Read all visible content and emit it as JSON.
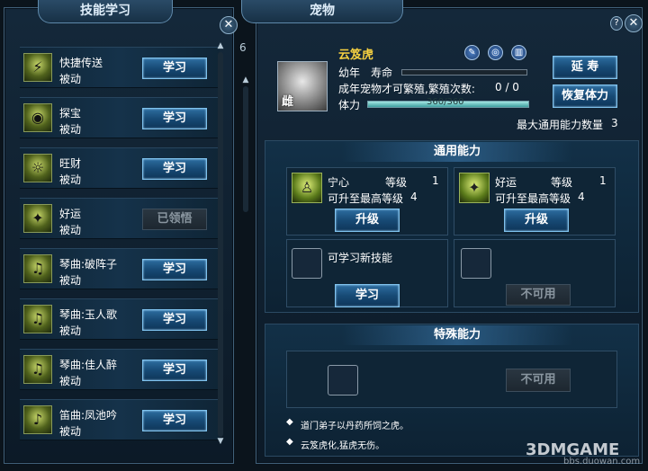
{
  "left_panel": {
    "title": "技能学习",
    "close_glyph": "✕",
    "skills": [
      {
        "name": "快捷传送",
        "type": "被动",
        "icon": "teleport-icon",
        "glyph": "⚡",
        "action": "学习",
        "enabled": true
      },
      {
        "name": "探宝",
        "type": "被动",
        "icon": "treasure-eye-icon",
        "glyph": "◉",
        "action": "学习",
        "enabled": true
      },
      {
        "name": "旺财",
        "type": "被动",
        "icon": "fortune-icon",
        "glyph": "☼",
        "action": "学习",
        "enabled": true
      },
      {
        "name": "好运",
        "type": "被动",
        "icon": "luck-icon",
        "glyph": "✦",
        "action": "已领悟",
        "enabled": false
      },
      {
        "name": "琴曲:破阵子",
        "type": "被动",
        "icon": "zither-icon",
        "glyph": "♫",
        "action": "学习",
        "enabled": true
      },
      {
        "name": "琴曲:玉人歌",
        "type": "被动",
        "icon": "zither-icon",
        "glyph": "♫",
        "action": "学习",
        "enabled": true
      },
      {
        "name": "琴曲:佳人醉",
        "type": "被动",
        "icon": "zither-icon",
        "glyph": "♫",
        "action": "学习",
        "enabled": true
      },
      {
        "name": "笛曲:凤池吟",
        "type": "被动",
        "icon": "flute-icon",
        "glyph": "♪",
        "action": "学习",
        "enabled": true
      }
    ],
    "side_number": "6"
  },
  "right_panel": {
    "title": "宠物",
    "help_glyph": "?",
    "close_glyph": "✕",
    "pet": {
      "name": "云笈虎",
      "gender": "雌",
      "age_label": "幼年",
      "lifespan_label": "寿命",
      "lifespan_fraction": 0,
      "breed_text": "成年宠物才可繁殖,繁殖次数:",
      "breed_count": "0 / 0",
      "stamina_label": "体力",
      "stamina_value": "360/360",
      "stamina_fraction": 1.0,
      "max_ability_label": "最大通用能力数量",
      "max_ability_count": "3"
    },
    "tools": [
      {
        "icon": "pen-icon",
        "glyph": "✎"
      },
      {
        "icon": "swirl-icon",
        "glyph": "◎"
      },
      {
        "icon": "trash-icon",
        "glyph": "▥"
      }
    ],
    "buttons": {
      "extend_life": "延 寿",
      "restore_stamina": "恢复体力"
    },
    "general": {
      "header": "通用能力",
      "abilities": [
        {
          "name": "宁心",
          "level_label": "等级",
          "level": "1",
          "max_text": "可升至最高等级",
          "max_level": "4",
          "icon": "meditation-icon",
          "glyph": "♙",
          "button": "升级"
        },
        {
          "name": "好运",
          "level_label": "等级",
          "level": "1",
          "max_text": "可升至最高等级",
          "max_level": "4",
          "icon": "luck-icon",
          "glyph": "✦",
          "button": "升级"
        }
      ],
      "learn_text": "可学习新技能",
      "learn_button": "学习",
      "unavailable_button": "不可用"
    },
    "special": {
      "header": "特殊能力",
      "unavailable_button": "不可用",
      "notes": [
        "道门弟子以丹药所饲之虎。",
        "云笈虎化,猛虎无伤。"
      ]
    }
  },
  "watermarks": {
    "site": "bbs.duowan.com",
    "brand": "3DMGAME"
  }
}
